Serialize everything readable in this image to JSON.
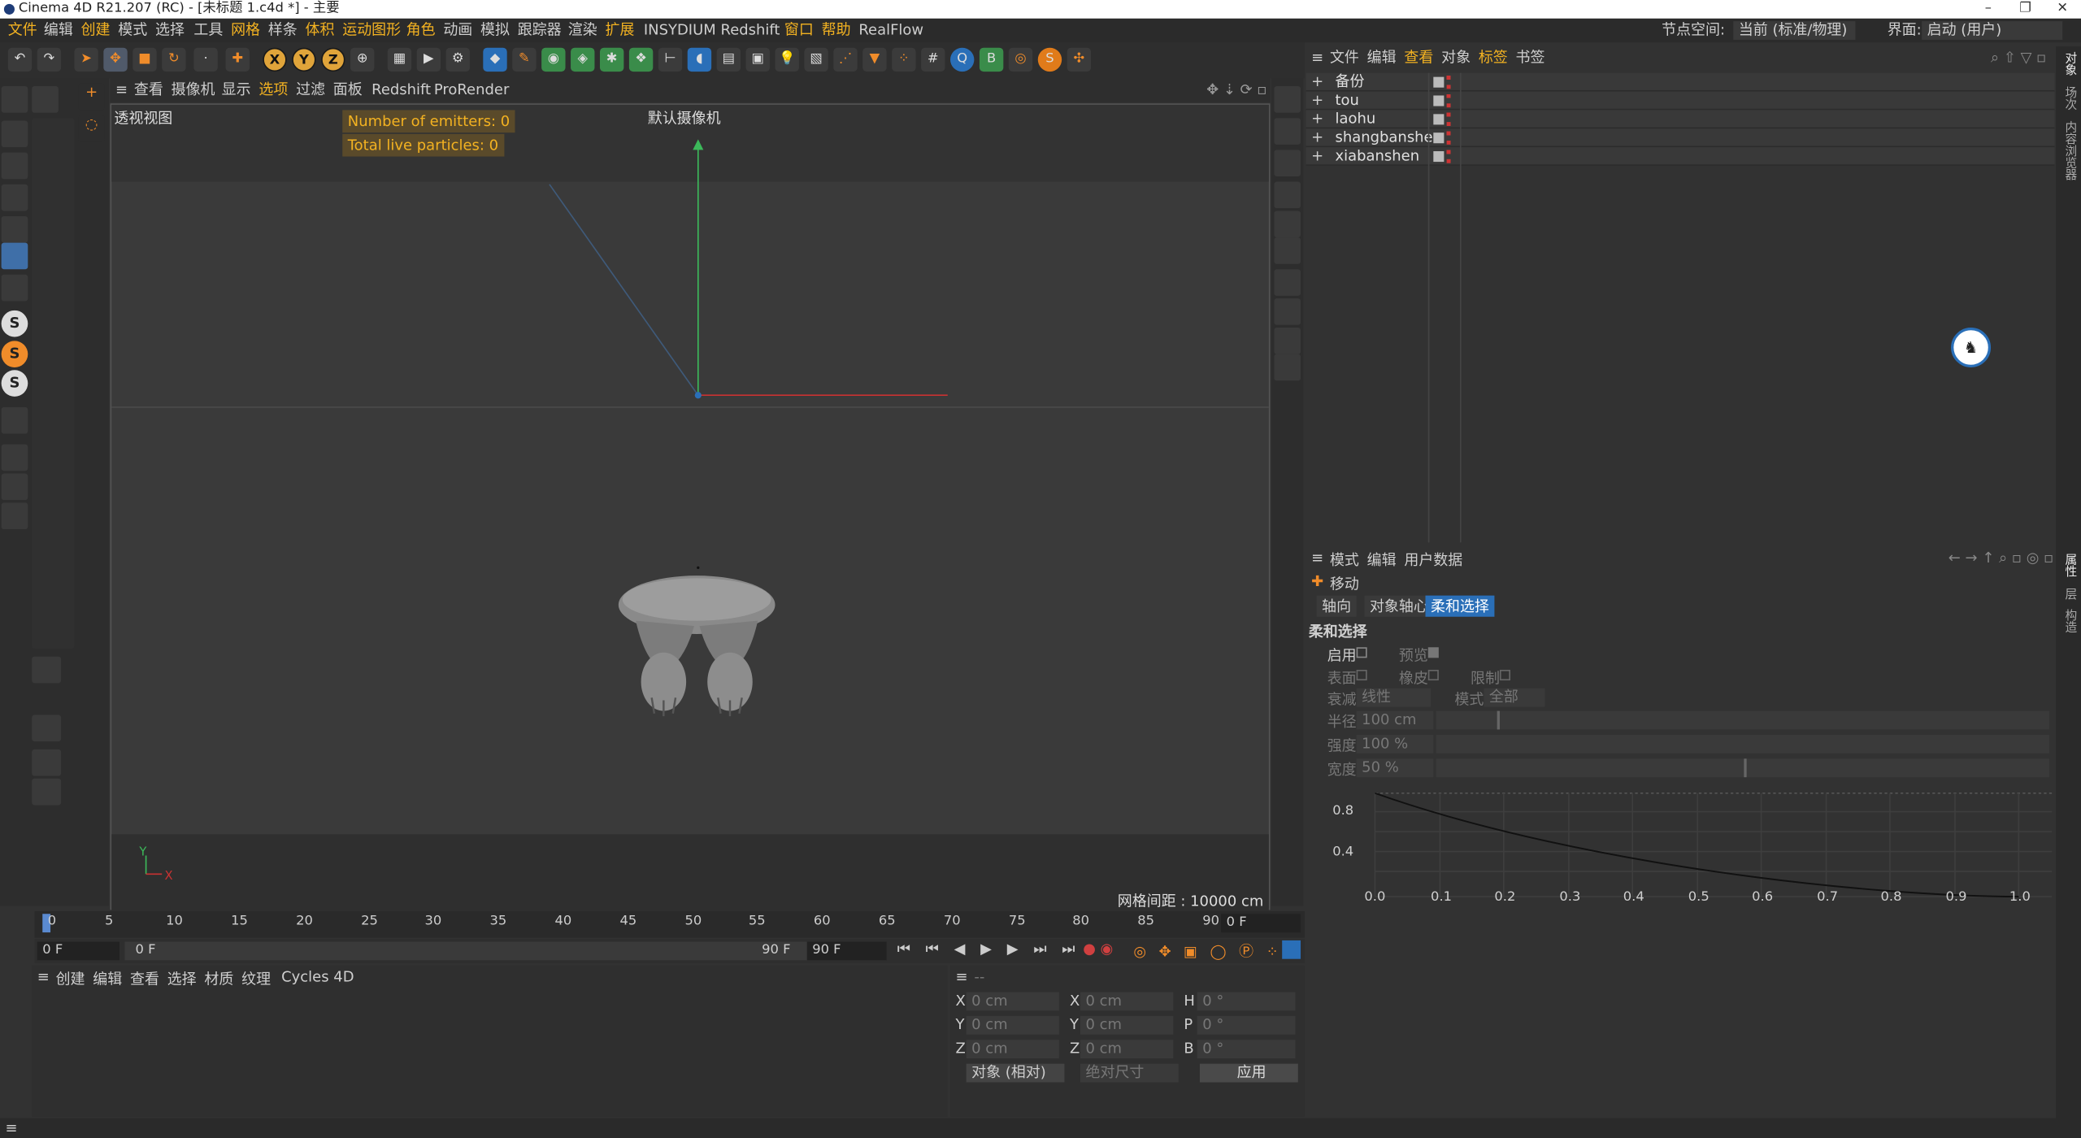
{
  "titlebar": {
    "title": "Cinema 4D R21.207 (RC) - [未标题 1.c4d *] - 主要",
    "minimize": "–",
    "restore": "❐",
    "close": "✕"
  },
  "menubar": {
    "items": [
      "文件",
      "编辑",
      "创建",
      "模式",
      "选择",
      "工具",
      "网格",
      "样条",
      "体积",
      "运动图形",
      "角色",
      "动画",
      "模拟",
      "跟踪器",
      "渲染",
      "扩展",
      "INSYDIUM",
      "Redshift",
      "窗口",
      "帮助",
      "RealFlow"
    ],
    "node_space_label": "节点空间:",
    "node_space_value": "当前 (标准/物理)",
    "interface_label": "界面:",
    "interface_value": "启动 (用户)"
  },
  "toolbar": {
    "x": "X",
    "y": "Y",
    "z": "Z"
  },
  "viewport": {
    "menu": [
      "查看",
      "摄像机",
      "显示",
      "选项",
      "过滤",
      "面板",
      "Redshift",
      "ProRender"
    ],
    "view_name": "透视视图",
    "camera": "默认摄像机",
    "emitters": "Number of emitters: 0",
    "particles": "Total live particles: 0",
    "grid_spacing": "网格间距 : 10000 cm",
    "axis_y": "Y",
    "axis_x": "X"
  },
  "objects": {
    "menu": [
      "文件",
      "编辑",
      "查看",
      "对象",
      "标签",
      "书签"
    ],
    "items": [
      "备份",
      "tou",
      "laohu",
      "shangbanshen",
      "xiabanshen"
    ]
  },
  "attributes": {
    "menu": [
      "模式",
      "编辑",
      "用户数据"
    ],
    "tool": "移动",
    "tabs": [
      "轴向",
      "对象轴心",
      "柔和选择"
    ],
    "section": "柔和选择",
    "enable": "启用",
    "preview": "预览",
    "surface": "表面",
    "rubber": "橡皮",
    "limit": "限制",
    "falloff_label": "衰减",
    "falloff_value": "线性",
    "mode_label": "模式",
    "mode_value": "全部",
    "radius_label": "半径",
    "radius_value": "100 cm",
    "strength_label": "强度",
    "strength_value": "100 %",
    "width_label": "宽度",
    "width_value": "50 %",
    "graph_y": [
      "0.8",
      "0.4"
    ],
    "graph_x": [
      "0.0",
      "0.1",
      "0.2",
      "0.3",
      "0.4",
      "0.5",
      "0.6",
      "0.7",
      "0.8",
      "0.9",
      "1.0"
    ]
  },
  "timeline": {
    "ticks": [
      "0",
      "5",
      "10",
      "15",
      "20",
      "25",
      "30",
      "35",
      "40",
      "45",
      "50",
      "55",
      "60",
      "65",
      "70",
      "75",
      "80",
      "85",
      "90"
    ],
    "current_frame": "0 F",
    "start": "0 F",
    "range_start": "0 F",
    "range_end": "90 F",
    "end": "90 F"
  },
  "materials": {
    "menu": [
      "创建",
      "编辑",
      "查看",
      "选择",
      "材质",
      "纹理",
      "Cycles 4D"
    ]
  },
  "coords": {
    "header": "--",
    "rows": [
      [
        "X",
        "0 cm",
        "X",
        "0 cm",
        "H",
        "0 °"
      ],
      [
        "Y",
        "0 cm",
        "Y",
        "0 cm",
        "P",
        "0 °"
      ],
      [
        "Z",
        "0 cm",
        "Z",
        "0 cm",
        "B",
        "0 °"
      ]
    ],
    "mode": "对象 (相对)",
    "size": "绝对尺寸",
    "apply": "应用"
  },
  "sidetabs": [
    "对象",
    "场次",
    "内容浏览器",
    "属性",
    "层",
    "构造"
  ]
}
